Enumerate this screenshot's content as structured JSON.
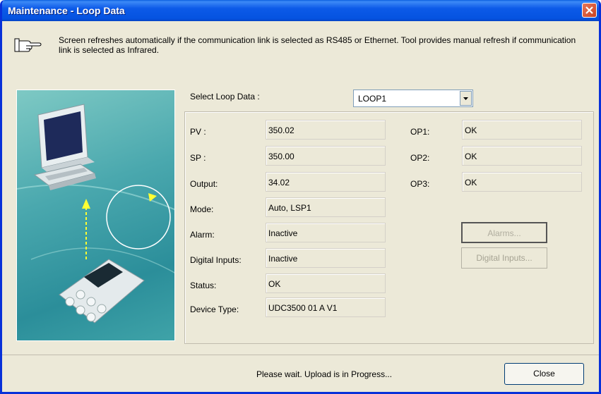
{
  "window": {
    "title": "Maintenance - Loop Data",
    "close_icon": "close-icon"
  },
  "info": {
    "icon": "pointing-hand-icon",
    "text": "Screen refreshes automatically if the communication link  is selected as RS485 or Ethernet. Tool provides manual refresh if communication link is selected as Infrared."
  },
  "loop_select": {
    "label": "Select Loop Data :",
    "value": "LOOP1"
  },
  "fields": [
    {
      "label": "PV :",
      "value": "350.02"
    },
    {
      "label": "SP :",
      "value": "350.00"
    },
    {
      "label": "Output:",
      "value": "34.02"
    },
    {
      "label": "Mode:",
      "value": "Auto, LSP1"
    },
    {
      "label": "Alarm:",
      "value": "Inactive"
    },
    {
      "label": "Digital Inputs:",
      "value": "Inactive"
    },
    {
      "label": "Status:",
      "value": "OK"
    },
    {
      "label": "Device Type:",
      "value": "UDC3500   01 A  V1"
    }
  ],
  "outputs": [
    {
      "label": "OP1:",
      "value": "OK"
    },
    {
      "label": "OP2:",
      "value": "OK"
    },
    {
      "label": "OP3:",
      "value": "OK"
    }
  ],
  "buttons": {
    "alarms": "Alarms...",
    "digital_inputs": "Digital Inputs...",
    "close": "Close"
  },
  "status_message": "Please wait. Upload is in Progress...",
  "colors": {
    "titlebar": "#0553e0",
    "window_bg": "#ece9d8",
    "art_bg": "#4aa8ae"
  }
}
